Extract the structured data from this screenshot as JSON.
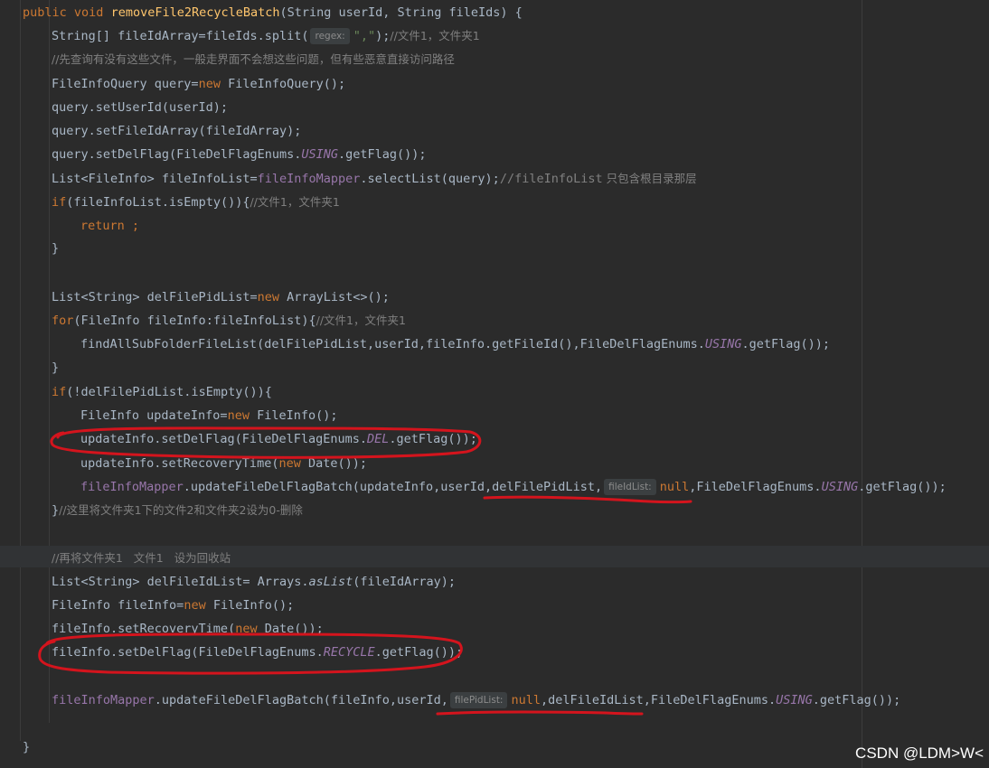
{
  "code": {
    "l1_kw1": "public",
    "l1_kw2": "void",
    "l1_fn": "removeFile2RecycleBatch",
    "l1_params": "(String userId, String fileIds) {",
    "l2_a": "String[] fileIdArray=fileIds.split(",
    "l2_hint": "regex:",
    "l2_str": "\",\"",
    "l2_b": ");",
    "l2_cmt": "//文件1，文件夹1",
    "l3_cmt": "//先查询有没有这些文件，一般走界面不会想这些问题，但有些恶意直接访问路径",
    "l4_a": "FileInfoQuery query=",
    "l4_new": "new",
    "l4_b": " FileInfoQuery();",
    "l5": "query.setUserId(userId);",
    "l6": "query.setFileIdArray(fileIdArray);",
    "l7_a": "query.setDelFlag(FileDelFlagEnums.",
    "l7_const": "USING",
    "l7_b": ".getFlag());",
    "l8_a": "List<FileInfo> fileInfoList=",
    "l8_fld": "fileInfoMapper",
    "l8_b": ".selectList(query);",
    "l8_cmt_code": "//fileInfoList",
    "l8_cmt": " 只包含根目录那层",
    "l9_if": "if",
    "l9_a": "(fileInfoList.isEmpty()){",
    "l9_cmt": "//文件1，文件夹1",
    "l10_ret": "return",
    "l10_b": " ;",
    "l11": "}",
    "l13_a": "List<String> delFilePidList=",
    "l13_new": "new",
    "l13_b": " ArrayList<>();",
    "l14_for": "for",
    "l14_a": "(FileInfo fileInfo:fileInfoList){",
    "l14_cmt": "//文件1，文件夹1",
    "l15_a": "findAllSubFolderFileList(delFilePidList,userId,fileInfo.getFileId(),FileDelFlagEnums.",
    "l15_const": "USING",
    "l15_b": ".getFlag());",
    "l16": "}",
    "l17_if": "if",
    "l17_a": "(!delFilePidList.isEmpty()){",
    "l18_a": "FileInfo updateInfo=",
    "l18_new": "new",
    "l18_b": " FileInfo();",
    "l19_a": "updateInfo.setDelFlag(FileDelFlagEnums.",
    "l19_const": "DEL",
    "l19_b": ".getFlag());",
    "l20_a": "updateInfo.setRecoveryTime(",
    "l20_new": "new",
    "l20_b": " Date());",
    "l21_fld": "fileInfoMapper",
    "l21_a": ".updateFileDelFlagBatch(updateInfo,userId,delFilePidList,",
    "l21_hint": "fileIdList:",
    "l21_null": "null",
    "l21_b": ",FileDelFlagEnums.",
    "l21_const": "USING",
    "l21_c": ".getFlag());",
    "l22_a": "}",
    "l22_cmt": "//这里将文件夹1下的文件2和文件夹2设为0-删除",
    "l24_cmt": "//再将文件夹1   文件1   设为回收站",
    "l25_a": "List<String> delFileIdList= Arrays.",
    "l25_static": "asList",
    "l25_b": "(fileIdArray);",
    "l26_a": "FileInfo fileInfo=",
    "l26_new": "new",
    "l26_b": " FileInfo();",
    "l27_a": "fileInfo.setRecoveryTime(",
    "l27_new": "new",
    "l27_b": " Date());",
    "l28_a": "fileInfo.setDelFlag(FileDelFlagEnums.",
    "l28_const": "RECYCLE",
    "l28_b": ".getFlag());",
    "l30_fld": "fileInfoMapper",
    "l30_a": ".updateFileDelFlagBatch(fileInfo,userId,",
    "l30_hint": "filePidList:",
    "l30_null": "null",
    "l30_b": ",delFileIdList,FileDelFlagEnums.",
    "l30_const": "USING",
    "l30_c": ".getFlag());",
    "l32": "}"
  },
  "watermark": "CSDN @LDM>W<",
  "colors": {
    "background": "#2b2b2b",
    "keyword": "#cc7832",
    "method_decl": "#ffc66d",
    "string": "#6a8759",
    "comment": "#808080",
    "field_constant": "#9876aa",
    "default_text": "#a9b7c6",
    "annotation_ink": "#d4141d"
  }
}
